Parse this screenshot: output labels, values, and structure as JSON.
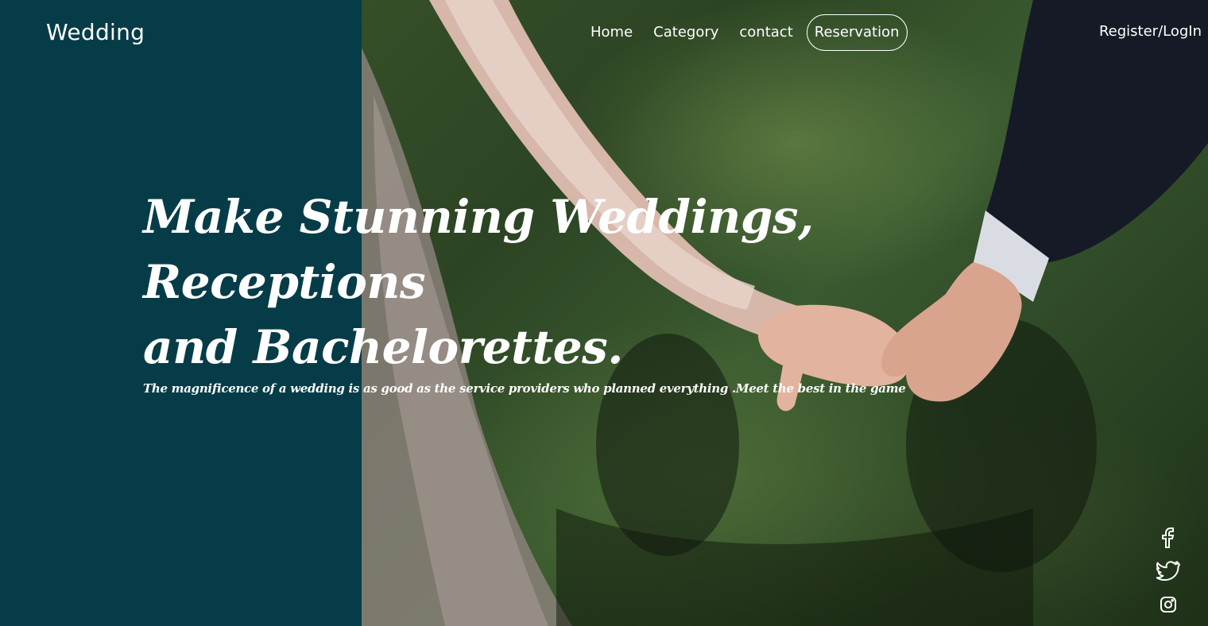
{
  "header": {
    "brand": "Wedding",
    "nav": [
      {
        "label": "Home"
      },
      {
        "label": "Category"
      },
      {
        "label": "contact"
      },
      {
        "label": "Reservation"
      }
    ],
    "auth_label": "Register/LogIn"
  },
  "hero": {
    "title_line1": "Make Stunning Weddings, Receptions",
    "title_line2": "and Bachelorettes.",
    "subtitle": "The magnificence of a wedding is as good as the service providers who planned everything .Meet the best in the game"
  },
  "social": {
    "icons": [
      "facebook-icon",
      "twitter-icon",
      "instagram-icon"
    ]
  },
  "colors": {
    "panel": "#053c48",
    "text": "#ffffff"
  }
}
